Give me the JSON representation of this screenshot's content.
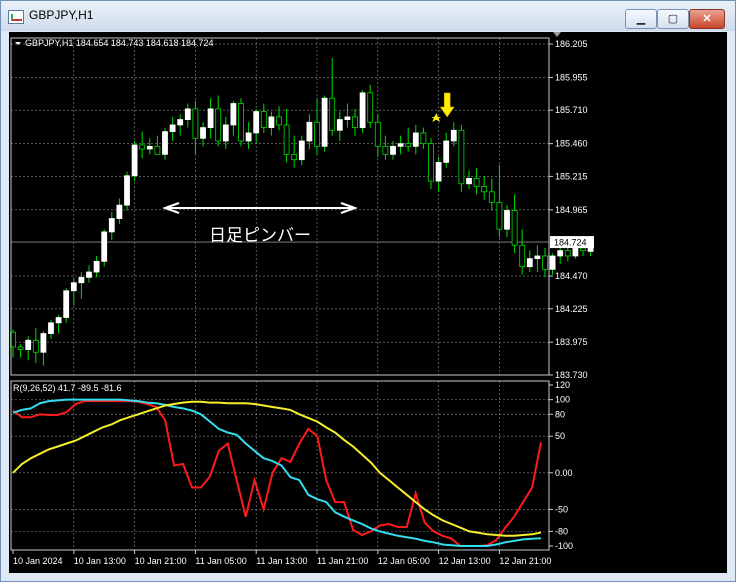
{
  "window": {
    "title": "GBPJPY,H1",
    "minimize_glyph": "▁",
    "maximize_glyph": "▢",
    "close_glyph": "✕",
    "app_icon": "chart-window-icon"
  },
  "colors": {
    "background": "#000000",
    "grid": "#8c8c8c",
    "axis": "#c8c8c8",
    "text": "#ffffff",
    "bull_candle": "#ffffff",
    "bear_candle": "#000000",
    "wick": "#00dd00",
    "price_line": "#8c8c8c",
    "rci_fast": "#ff1a1a",
    "rci_mid": "#33ddee",
    "rci_slow": "#f5ee2a",
    "signal": "#ffee00"
  },
  "chart_data": [
    {
      "type": "candlestick",
      "title": "GBPJPY,H1  184.654 184.743 184.618 184.724",
      "ylim": [
        183.73,
        186.25
      ],
      "y_ticks": [
        "186.205",
        "185.955",
        "185.710",
        "185.460",
        "185.215",
        "184.965",
        "184.724",
        "184.470",
        "184.225",
        "183.975",
        "183.730"
      ],
      "current_price": "184.724",
      "x_labels": [
        "10 Jan 2024",
        "10 Jan 13:00",
        "10 Jan 21:00",
        "11 Jan 05:00",
        "11 Jan 13:00",
        "11 Jan 21:00",
        "12 Jan 05:00",
        "12 Jan 13:00",
        "12 Jan 21:00"
      ],
      "candles": [
        [
          184.05,
          184.07,
          183.86,
          183.94
        ],
        [
          183.94,
          183.96,
          183.86,
          183.92
        ],
        [
          183.92,
          184.02,
          183.84,
          183.99
        ],
        [
          183.99,
          184.08,
          183.82,
          183.9
        ],
        [
          183.9,
          184.06,
          183.8,
          184.04
        ],
        [
          184.04,
          184.14,
          184.0,
          184.12
        ],
        [
          184.12,
          184.18,
          184.04,
          184.16
        ],
        [
          184.16,
          184.38,
          184.12,
          184.36
        ],
        [
          184.36,
          184.46,
          184.25,
          184.42
        ],
        [
          184.42,
          184.5,
          184.3,
          184.46
        ],
        [
          184.46,
          184.55,
          184.42,
          184.5
        ],
        [
          184.5,
          184.62,
          184.46,
          184.58
        ],
        [
          184.58,
          184.82,
          184.54,
          184.8
        ],
        [
          184.8,
          184.95,
          184.74,
          184.9
        ],
        [
          184.9,
          185.05,
          184.86,
          185.0
        ],
        [
          185.0,
          185.25,
          184.96,
          185.22
        ],
        [
          185.22,
          185.48,
          185.18,
          185.45
        ],
        [
          185.45,
          185.55,
          185.35,
          185.42
        ],
        [
          185.42,
          185.5,
          185.38,
          185.44
        ],
        [
          185.44,
          185.52,
          185.4,
          185.38
        ],
        [
          185.38,
          185.58,
          185.34,
          185.55
        ],
        [
          185.55,
          185.66,
          185.48,
          185.6
        ],
        [
          185.6,
          185.68,
          185.52,
          185.64
        ],
        [
          185.64,
          185.76,
          185.58,
          185.72
        ],
        [
          185.72,
          185.78,
          185.38,
          185.5
        ],
        [
          185.5,
          185.62,
          185.44,
          185.58
        ],
        [
          185.58,
          185.8,
          185.5,
          185.72
        ],
        [
          185.72,
          185.82,
          185.44,
          185.48
        ],
        [
          185.48,
          185.66,
          185.42,
          185.6
        ],
        [
          185.6,
          185.78,
          185.52,
          185.76
        ],
        [
          185.76,
          185.8,
          185.44,
          185.48
        ],
        [
          185.48,
          185.62,
          185.42,
          185.54
        ],
        [
          185.54,
          185.72,
          185.46,
          185.7
        ],
        [
          185.7,
          185.76,
          185.54,
          185.58
        ],
        [
          185.58,
          185.7,
          185.52,
          185.66
        ],
        [
          185.66,
          185.74,
          185.56,
          185.6
        ],
        [
          185.6,
          185.72,
          185.32,
          185.38
        ],
        [
          185.38,
          185.52,
          185.28,
          185.34
        ],
        [
          185.34,
          185.52,
          185.3,
          185.48
        ],
        [
          185.48,
          185.68,
          185.42,
          185.62
        ],
        [
          185.62,
          185.8,
          185.38,
          185.44
        ],
        [
          185.44,
          185.82,
          185.4,
          185.8
        ],
        [
          185.8,
          186.1,
          185.52,
          185.56
        ],
        [
          185.56,
          185.7,
          185.48,
          185.64
        ],
        [
          185.64,
          185.76,
          185.58,
          185.66
        ],
        [
          185.66,
          185.72,
          185.52,
          185.58
        ],
        [
          185.58,
          185.86,
          185.54,
          185.84
        ],
        [
          185.84,
          185.9,
          185.58,
          185.62
        ],
        [
          185.62,
          185.68,
          185.36,
          185.44
        ],
        [
          185.44,
          185.52,
          185.34,
          185.38
        ],
        [
          185.38,
          185.48,
          185.34,
          185.44
        ],
        [
          185.44,
          185.52,
          185.38,
          185.46
        ],
        [
          185.46,
          185.58,
          185.4,
          185.44
        ],
        [
          185.44,
          185.6,
          185.38,
          185.54
        ],
        [
          185.54,
          185.58,
          185.42,
          185.46
        ],
        [
          185.46,
          185.5,
          185.12,
          185.18
        ],
        [
          185.18,
          185.36,
          185.1,
          185.32
        ],
        [
          185.32,
          185.54,
          185.28,
          185.48
        ],
        [
          185.48,
          185.62,
          185.44,
          185.56
        ],
        [
          185.56,
          185.6,
          185.1,
          185.16
        ],
        [
          185.16,
          185.26,
          185.12,
          185.2
        ],
        [
          185.2,
          185.28,
          185.08,
          185.14
        ],
        [
          185.14,
          185.22,
          185.04,
          185.1
        ],
        [
          185.1,
          185.2,
          184.96,
          185.02
        ],
        [
          185.02,
          185.3,
          184.76,
          184.82
        ],
        [
          184.82,
          185.0,
          184.76,
          184.96
        ],
        [
          184.96,
          185.08,
          184.64,
          184.7
        ],
        [
          184.7,
          184.82,
          184.48,
          184.54
        ],
        [
          184.54,
          184.66,
          184.5,
          184.6
        ],
        [
          184.6,
          184.7,
          184.5,
          184.62
        ],
        [
          184.62,
          184.68,
          184.46,
          184.52
        ],
        [
          184.52,
          184.64,
          184.48,
          184.62
        ],
        [
          184.62,
          184.7,
          184.56,
          184.66
        ],
        [
          184.66,
          184.72,
          184.58,
          184.62
        ],
        [
          184.62,
          184.74,
          184.6,
          184.68
        ],
        [
          184.68,
          184.74,
          184.62,
          184.66
        ],
        [
          184.654,
          184.743,
          184.618,
          184.724
        ]
      ],
      "annotation_text": "日足ピンバー",
      "annotation_span_candles": [
        20,
        45
      ],
      "signal_candle": 57
    },
    {
      "type": "line",
      "title": "R(9,26,52) 41.7 -89.5 -81.6",
      "ylim": [
        -100,
        120
      ],
      "y_ticks": [
        "120",
        "100",
        "80",
        "50",
        "0.00",
        "-50",
        "-80",
        "-100"
      ],
      "series": [
        {
          "color_key": "rci_fast",
          "values": [
            85,
            76,
            76,
            80,
            79,
            79,
            83,
            94,
            98,
            98,
            98,
            98,
            98,
            98,
            97,
            94,
            90,
            72,
            10,
            12,
            -20,
            -20,
            -5,
            30,
            40,
            -10,
            -60,
            -10,
            -50,
            0,
            20,
            15,
            40,
            60,
            50,
            -10,
            -40,
            -40,
            -78,
            -85,
            -80,
            -72,
            -70,
            -74,
            -74,
            -28,
            -68,
            -80,
            -86,
            -90,
            -100,
            -100,
            -100,
            -99,
            -92,
            -75,
            -60,
            -40,
            -20,
            41.7
          ]
        },
        {
          "color_key": "rci_mid",
          "values": [
            82,
            86,
            88,
            95,
            98,
            99,
            100,
            100,
            100,
            100,
            100,
            100,
            100,
            99,
            98,
            96,
            95,
            93,
            90,
            88,
            85,
            80,
            70,
            60,
            55,
            52,
            40,
            30,
            20,
            16,
            10,
            -6,
            -10,
            -30,
            -36,
            -40,
            -54,
            -60,
            -65,
            -70,
            -76,
            -80,
            -83,
            -86,
            -88,
            -90,
            -93,
            -95,
            -98,
            -99,
            -100,
            -100,
            -100,
            -100,
            -98,
            -95,
            -93,
            -91,
            -90,
            -89.5
          ]
        },
        {
          "color_key": "rci_slow",
          "values": [
            0,
            12,
            20,
            26,
            32,
            36,
            40,
            44,
            50,
            56,
            62,
            66,
            72,
            76,
            80,
            84,
            88,
            92,
            94,
            96,
            97,
            97,
            96,
            96,
            95,
            95,
            95,
            94,
            92,
            90,
            88,
            86,
            80,
            75,
            70,
            62,
            55,
            45,
            36,
            25,
            14,
            0,
            -10,
            -20,
            -30,
            -40,
            -50,
            -58,
            -65,
            -70,
            -75,
            -80,
            -82,
            -84,
            -85,
            -86,
            -86,
            -85,
            -84,
            -81.6
          ]
        }
      ]
    }
  ]
}
